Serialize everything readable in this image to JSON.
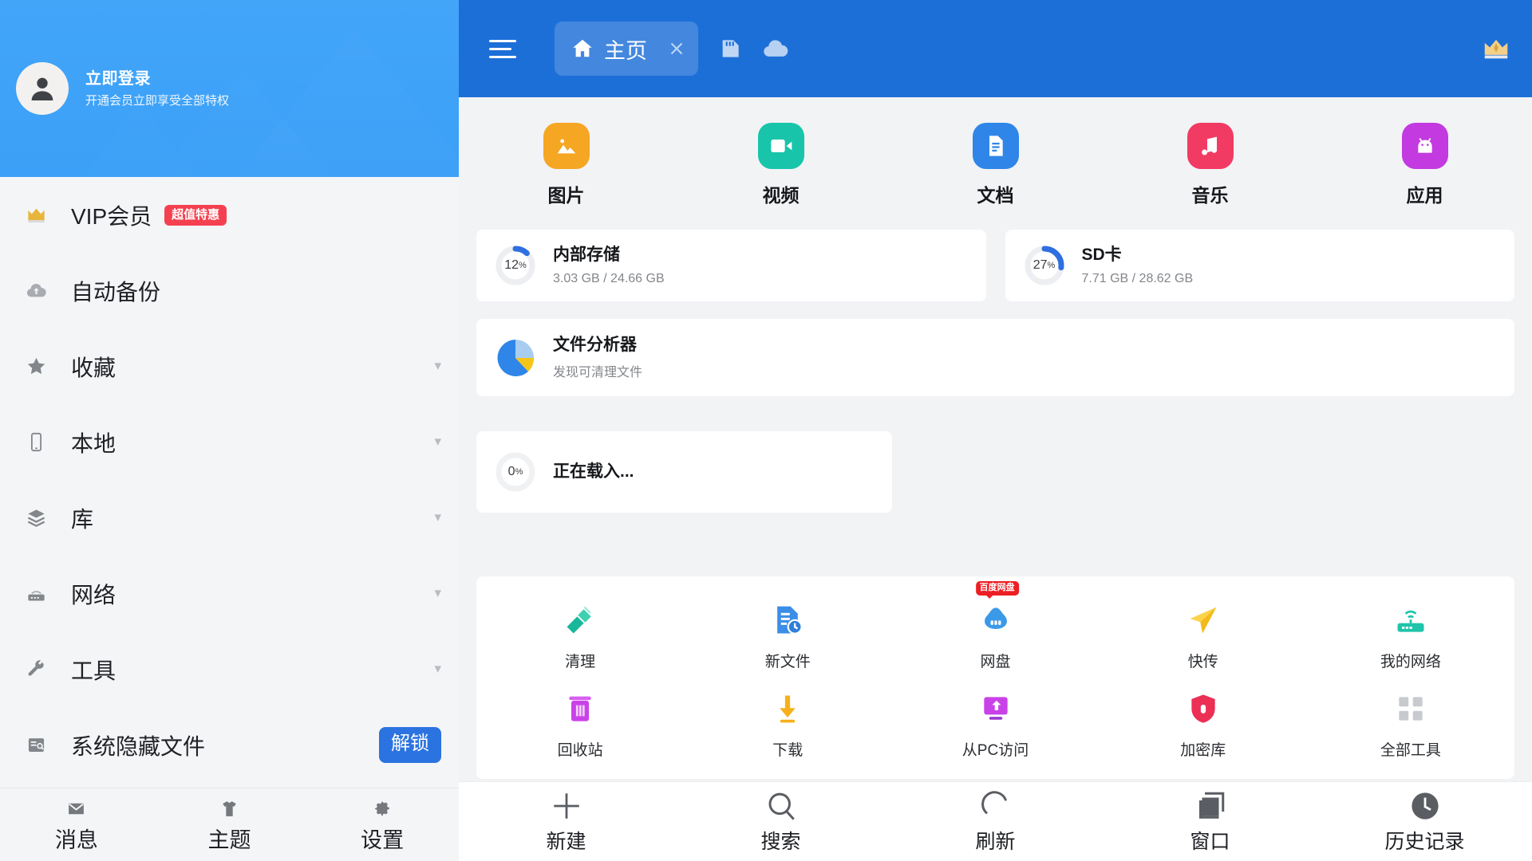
{
  "sidebar": {
    "account": {
      "login_title": "立即登录",
      "login_sub": "开通会员立即享受全部特权",
      "avatar_icon": "person-icon"
    },
    "items": [
      {
        "label": "VIP会员",
        "icon": "crown-icon",
        "badge": "超值特惠",
        "chevron": false
      },
      {
        "label": "自动备份",
        "icon": "cloud-backup-icon",
        "chevron": false
      },
      {
        "label": "收藏",
        "icon": "star-icon",
        "chevron": true
      },
      {
        "label": "本地",
        "icon": "phone-icon",
        "chevron": true
      },
      {
        "label": "库",
        "icon": "layers-icon",
        "chevron": true
      },
      {
        "label": "网络",
        "icon": "router-icon",
        "chevron": true
      },
      {
        "label": "工具",
        "icon": "wrench-icon",
        "chevron": true
      },
      {
        "label": "系统隐藏文件",
        "icon": "hidden-file-icon",
        "button": "解锁"
      }
    ],
    "bottom_nav": [
      {
        "label": "消息",
        "icon": "mail-icon"
      },
      {
        "label": "主题",
        "icon": "tshirt-icon"
      },
      {
        "label": "设置",
        "icon": "gear-icon"
      }
    ]
  },
  "topbar": {
    "menu_icon": "hamburger-icon",
    "tab": {
      "label": "主页",
      "icon": "home-icon",
      "close_icon": "close-icon"
    },
    "icons": [
      {
        "name": "sdcard-icon"
      },
      {
        "name": "cloud-icon"
      }
    ],
    "vip_icon": "crown-icon"
  },
  "categories": [
    {
      "label": "图片",
      "icon": "image-icon",
      "color": "#f5a623"
    },
    {
      "label": "视频",
      "icon": "video-icon",
      "color": "#18c5aa"
    },
    {
      "label": "文档",
      "icon": "document-icon",
      "color": "#2f86e8"
    },
    {
      "label": "音乐",
      "icon": "music-icon",
      "color": "#f23b63"
    },
    {
      "label": "应用",
      "icon": "android-app-icon",
      "color": "#c23ae0"
    }
  ],
  "storage": [
    {
      "title": "内部存储",
      "sub": "3.03 GB / 24.66 GB",
      "percent": 12,
      "percent_label": "12",
      "percent_unit": "%"
    },
    {
      "title": "SD卡",
      "sub": "7.71 GB / 28.62 GB",
      "percent": 27,
      "percent_label": "27",
      "percent_unit": "%"
    }
  ],
  "analyzer": {
    "title": "文件分析器",
    "sub": "发现可清理文件",
    "icon": "pie-chart-icon"
  },
  "loading": {
    "title": "正在载入...",
    "percent": 0,
    "percent_label": "0",
    "percent_unit": "%"
  },
  "shortcuts": {
    "row1": [
      {
        "label": "清理",
        "icon": "broom-icon"
      },
      {
        "label": "新文件",
        "icon": "new-file-icon"
      },
      {
        "label": "网盘",
        "icon": "netdisk-icon",
        "tag": "百度网盘"
      },
      {
        "label": "快传",
        "icon": "send-icon"
      },
      {
        "label": "我的网络",
        "icon": "router-wifi-icon"
      }
    ],
    "row2": [
      {
        "label": "回收站",
        "icon": "trash-icon"
      },
      {
        "label": "下载",
        "icon": "download-icon"
      },
      {
        "label": "从PC访问",
        "icon": "pc-access-icon"
      },
      {
        "label": "加密库",
        "icon": "shield-lock-icon"
      },
      {
        "label": "全部工具",
        "icon": "grid-icon"
      }
    ]
  },
  "bottombar": [
    {
      "label": "新建",
      "icon": "plus-icon"
    },
    {
      "label": "搜索",
      "icon": "search-icon"
    },
    {
      "label": "刷新",
      "icon": "refresh-icon"
    },
    {
      "label": "窗口",
      "icon": "windows-icon"
    },
    {
      "label": "历史记录",
      "icon": "history-icon"
    }
  ],
  "colors": {
    "topbar": "#1d6fd8",
    "sidebar_header": "#42a5f8",
    "accent": "#2b73e0",
    "badge_red": "#f5414f",
    "page_bg": "#f2f3f5"
  }
}
